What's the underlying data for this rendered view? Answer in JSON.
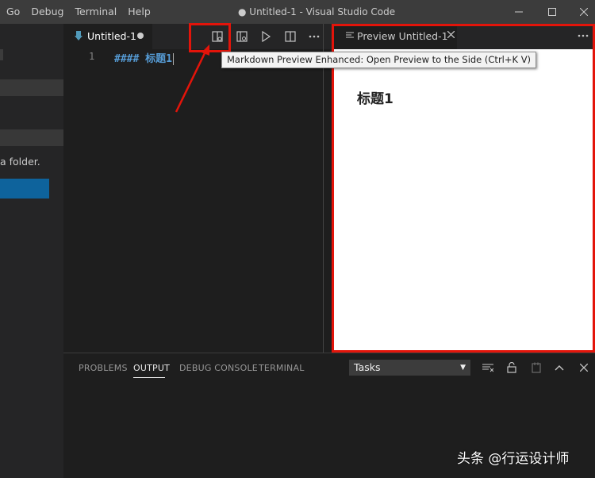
{
  "titlebar": {
    "menu": [
      "Go",
      "Debug",
      "Terminal",
      "Help"
    ],
    "title": "● Untitled-1 - Visual Studio Code"
  },
  "sidebar": {
    "text": "a folder."
  },
  "editor": {
    "tab": {
      "label": "Untitled-1"
    },
    "line_number": "1",
    "code": "#### 标题1"
  },
  "tooltip": "Markdown Preview Enhanced: Open Preview to the Side (Ctrl+K V)",
  "preview": {
    "tab_label": "Preview Untitled-1",
    "heading": "标题1"
  },
  "panel": {
    "tabs": [
      "PROBLEMS",
      "OUTPUT",
      "DEBUG CONSOLE",
      "TERMINAL"
    ],
    "active_tab": "OUTPUT",
    "tasks_select": "Tasks"
  },
  "watermark": "头条 @行运设计师",
  "colors": {
    "accent_red": "#e3140a",
    "button_blue": "#0e639c",
    "markdown_blue": "#569cd6"
  }
}
